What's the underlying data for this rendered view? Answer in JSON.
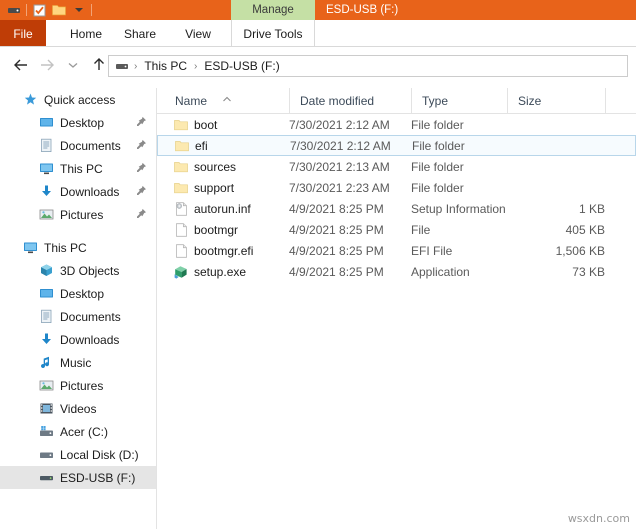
{
  "titlebar": {
    "quick_access_icons": [
      "drive-icon",
      "properties-checkbox-icon",
      "new-folder-icon",
      "customize-chevron-icon"
    ],
    "contextual_tab_group": "Manage",
    "window_title": "ESD-USB (F:)",
    "bg_color": "#e8631a",
    "contextual_color": "#c5e0a5"
  },
  "ribbon": {
    "file_tab": "File",
    "file_tab_color": "#bf3d06",
    "tabs": [
      {
        "label": "Home"
      },
      {
        "label": "Share"
      },
      {
        "label": "View"
      },
      {
        "label": "Drive Tools"
      }
    ]
  },
  "navbar": {
    "back_icon": "arrow-left-icon",
    "forward_icon": "arrow-right-icon",
    "recent_icon": "chevron-down-icon",
    "up_icon": "arrow-up-icon",
    "breadcrumb_icon": "drive-icon",
    "breadcrumb": [
      "This PC",
      "ESD-USB (F:)"
    ],
    "separator": "›"
  },
  "navpane": {
    "quick_access": {
      "label": "Quick access",
      "icon": "star-pin-icon",
      "items": [
        {
          "label": "Desktop",
          "icon": "desktop-icon",
          "pinned": true
        },
        {
          "label": "Documents",
          "icon": "documents-icon",
          "pinned": true
        },
        {
          "label": "This PC",
          "icon": "computer-icon",
          "pinned": true
        },
        {
          "label": "Downloads",
          "icon": "downloads-icon",
          "pinned": true
        },
        {
          "label": "Pictures",
          "icon": "pictures-icon",
          "pinned": true
        }
      ]
    },
    "this_pc": {
      "label": "This PC",
      "icon": "computer-icon",
      "items": [
        {
          "label": "3D Objects",
          "icon": "cube-icon"
        },
        {
          "label": "Desktop",
          "icon": "desktop-icon"
        },
        {
          "label": "Documents",
          "icon": "documents-icon"
        },
        {
          "label": "Downloads",
          "icon": "downloads-icon"
        },
        {
          "label": "Music",
          "icon": "music-note-icon"
        },
        {
          "label": "Pictures",
          "icon": "pictures-icon"
        },
        {
          "label": "Videos",
          "icon": "video-icon"
        },
        {
          "label": "Acer (C:)",
          "icon": "windows-drive-icon"
        },
        {
          "label": "Local Disk (D:)",
          "icon": "drive-icon"
        },
        {
          "label": "ESD-USB (F:)",
          "icon": "usb-drive-icon",
          "selected": true
        }
      ]
    }
  },
  "filelist": {
    "columns": [
      {
        "label": "Name",
        "sorted": "asc"
      },
      {
        "label": "Date modified"
      },
      {
        "label": "Type"
      },
      {
        "label": "Size"
      }
    ],
    "rows": [
      {
        "name": "boot",
        "date": "7/30/2021 2:12 AM",
        "type": "File folder",
        "size": "",
        "icon": "folder-icon",
        "selected": false
      },
      {
        "name": "efi",
        "date": "7/30/2021 2:12 AM",
        "type": "File folder",
        "size": "",
        "icon": "folder-icon",
        "selected": true
      },
      {
        "name": "sources",
        "date": "7/30/2021 2:13 AM",
        "type": "File folder",
        "size": "",
        "icon": "folder-icon",
        "selected": false
      },
      {
        "name": "support",
        "date": "7/30/2021 2:23 AM",
        "type": "File folder",
        "size": "",
        "icon": "folder-icon",
        "selected": false
      },
      {
        "name": "autorun.inf",
        "date": "4/9/2021 8:25 PM",
        "type": "Setup Information",
        "size": "1 KB",
        "icon": "setup-info-icon",
        "selected": false
      },
      {
        "name": "bootmgr",
        "date": "4/9/2021 8:25 PM",
        "type": "File",
        "size": "405 KB",
        "icon": "generic-file-icon",
        "selected": false
      },
      {
        "name": "bootmgr.efi",
        "date": "4/9/2021 8:25 PM",
        "type": "EFI File",
        "size": "1,506 KB",
        "icon": "generic-file-icon",
        "selected": false
      },
      {
        "name": "setup.exe",
        "date": "4/9/2021 8:25 PM",
        "type": "Application",
        "size": "73 KB",
        "icon": "application-icon",
        "selected": false
      }
    ]
  },
  "watermark": "wsxdn.com"
}
